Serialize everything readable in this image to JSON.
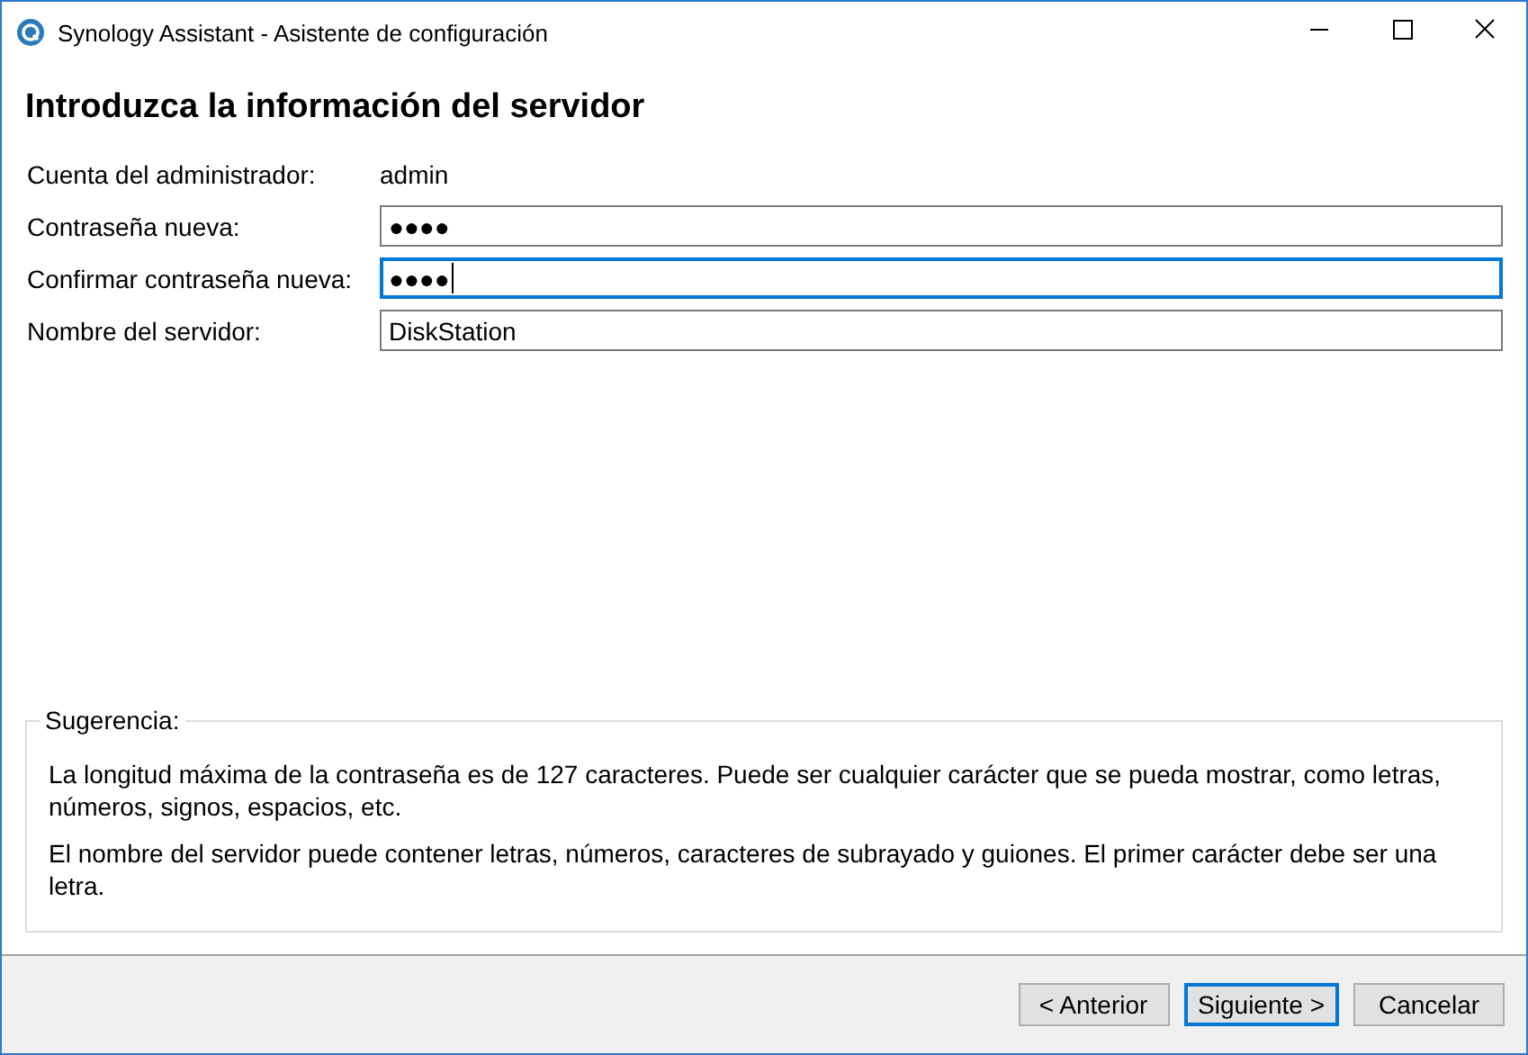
{
  "window": {
    "title": "Synology Assistant - Asistente de configuración"
  },
  "heading": "Introduzca la información del servidor",
  "administrator": {
    "label": "Cuenta del administrador:",
    "value": "admin"
  },
  "fields": [
    {
      "label": "Contraseña nueva:",
      "value": "●●●●",
      "focused": false
    },
    {
      "label": "Confirmar contraseña nueva:",
      "value": "●●●●",
      "focused": true
    },
    {
      "label": "Nombre del servidor:",
      "value": "DiskStation",
      "focused": false
    }
  ],
  "hint": {
    "title": "Sugerencia:",
    "paragraphs": [
      "La longitud máxima de la contraseña es de 127 caracteres. Puede ser cualquier carácter que se pueda mostrar, como letras, números, signos, espacios, etc.",
      "El nombre del servidor puede contener letras, números, caracteres de subrayado y guiones. El primer carácter debe ser una letra."
    ]
  },
  "buttons": [
    {
      "label": "< Anterior",
      "default": false
    },
    {
      "label": "Siguiente >",
      "default": true
    },
    {
      "label": "Cancelar",
      "default": false
    }
  ]
}
